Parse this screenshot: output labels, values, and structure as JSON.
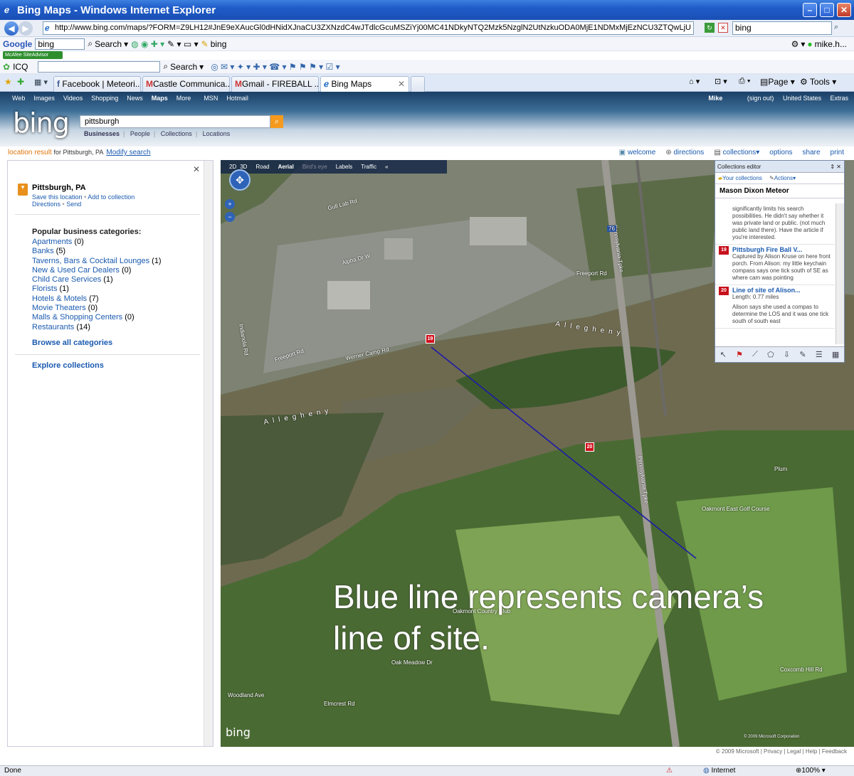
{
  "window": {
    "title": "Bing Maps - Windows Internet Explorer"
  },
  "address": {
    "url": "http://www.bing.com/maps/?FORM=Z9LH12#JnE9eXAucGl0dHNidXJnaCU3ZXNzdC4wJTdlcGcuMSZiYj00MC41NDkyNTQ2Mzk5NzglN2UtNzkuODA0MjE1NDMxMjEzNCU3ZTQwLjU",
    "search": "bing"
  },
  "toolbar_google": {
    "brand": "Google",
    "query": "bing",
    "search": "Search",
    "bing": "bing",
    "user": "mike.h..."
  },
  "toolbar_mcafee": {
    "label": "McAfee SiteAdvisor"
  },
  "toolbar_icq": {
    "label": "ICQ",
    "search": "Search"
  },
  "tabs": [
    {
      "label": "Facebook | Meteori..."
    },
    {
      "label": "Castle Communica..."
    },
    {
      "label": "Gmail - FIREBALL ..."
    },
    {
      "label": "Bing Maps"
    }
  ],
  "ie_tools": {
    "page": "Page",
    "tools": "Tools"
  },
  "bing": {
    "logo": "bing",
    "topnav": [
      "Web",
      "Images",
      "Videos",
      "Shopping",
      "News",
      "Maps",
      "More",
      "MSN",
      "Hotmail"
    ],
    "user": "Mike",
    "signout": "(sign out)",
    "region": "United States",
    "extras": "Extras",
    "query": "pittsburgh",
    "scopes": [
      "Businesses",
      "People",
      "Collections",
      "Locations"
    ]
  },
  "locationbar": {
    "result": "location result",
    "for": "for Pittsburgh, PA",
    "modify": "Modify search",
    "tools": [
      "welcome",
      "directions",
      "collections",
      "options",
      "share",
      "print"
    ]
  },
  "leftpanel": {
    "place": "Pittsburgh, PA",
    "save": "Save this location",
    "add": "Add to collection",
    "directions": "Directions",
    "send": "Send",
    "categories_title": "Popular business categories:",
    "categories": [
      {
        "name": "Apartments",
        "count": "(0)"
      },
      {
        "name": "Banks",
        "count": "(5)"
      },
      {
        "name": "Taverns, Bars & Cocktail Lounges",
        "count": "(1)"
      },
      {
        "name": "New & Used Car Dealers",
        "count": "(0)"
      },
      {
        "name": "Child Care Services",
        "count": "(1)"
      },
      {
        "name": "Florists",
        "count": "(1)"
      },
      {
        "name": "Hotels & Motels",
        "count": "(7)"
      },
      {
        "name": "Movie Theaters",
        "count": "(0)"
      },
      {
        "name": "Malls & Shopping Centers",
        "count": "(0)"
      },
      {
        "name": "Restaurants",
        "count": "(14)"
      }
    ],
    "browse": "Browse all categories",
    "explore": "Explore collections"
  },
  "map": {
    "toolbar": [
      "2D",
      "3D",
      "Road",
      "Aerial",
      "Bird's eye",
      "Labels",
      "Traffic"
    ],
    "overlay_line1": "Blue line represents camera’s",
    "overlay_line2": "line of site.",
    "marker_19": "19",
    "marker_20": "20",
    "labels": {
      "gull": "Gull Lab Rd",
      "freeport": "Freeport Rd",
      "freeport2": "Freeport Rd",
      "allegheny1": "Allegheny",
      "allegheny2": "Allegheny",
      "penn": "Pennsylvania Tpke",
      "penn2": "Pennsylvania Tpke",
      "i76": "76",
      "oakmont": "Oakmont Country Club",
      "golf": "Oakmont East Golf Course",
      "plum": "Plum",
      "coxcomb": "Coxcomb Hill Rd",
      "oakmeadow": "Oak Meadow Dr",
      "woodland": "Woodland Ave",
      "elmcrest": "Elmcrest Rd",
      "indianola": "Indianola Rd",
      "alpha": "Alpha Dr W",
      "werner": "Werner Camp Rd"
    },
    "watermark": "bing",
    "copyright": "© 2009 Microsoft Corporation"
  },
  "collections": {
    "header": "Collections editor",
    "your": "Your collections",
    "actions": "Actions",
    "title": "Mason Dixon Meteor",
    "intro": "significantly limits his search possibilities. He didn't say whether it was private land or public. (not much public land there). Have the article if you're interested.",
    "items": [
      {
        "num": "19",
        "title": "Pittsburgh Fire Ball V...",
        "text": "Captured by Alison Kruse on here front porch. From Alison: my little keychain compass says one tick south of SE as where cam was pointing"
      },
      {
        "num": "20",
        "title": "Line of site of Alison...",
        "length": "Length: 0.77 miles",
        "text": "Alison says she used a compas to determine the LOS and it was one tick south of south east"
      }
    ]
  },
  "footer": {
    "copy": "© 2009 Microsoft",
    "privacy": "Privacy",
    "legal": "Legal",
    "help": "Help",
    "feedback": "Feedback"
  },
  "status": {
    "left": "Done",
    "zone": "Internet",
    "zoom": "100%"
  }
}
